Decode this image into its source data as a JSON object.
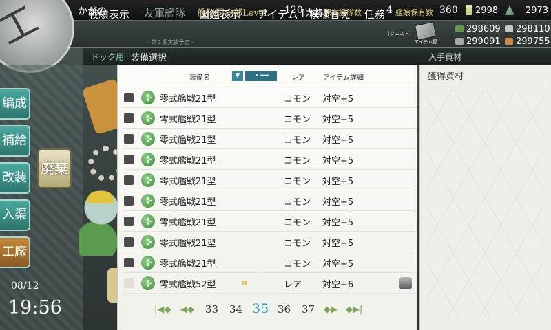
{
  "header": {
    "admiral_name": "かがの",
    "hq_label": "艦隊司令部Level.",
    "hq_level": "120",
    "rank": "[大将]",
    "ships_label": "保有艦隊数",
    "ships_count": "4",
    "equipment_label": "艦娘保有数",
    "equipment_count": "360",
    "bucket_count": "2998",
    "devmat_count": "2973"
  },
  "badge": {
    "text": "工"
  },
  "menu": {
    "record": "戦績表示",
    "friend": "友軍艦隊",
    "friend_sub": "- 第２期実装予定 -",
    "library": "図鑑表示",
    "items": "アイテム",
    "remodel": "模様替え",
    "quest": "任務",
    "quest_sub": "(クエスト)",
    "item_shop": "アイテム屋"
  },
  "resources": {
    "fuel": "298609",
    "ammo": "298110",
    "steel": "299091",
    "bauxite": "299755"
  },
  "breadcrumb": {
    "dock": "ドック用",
    "select": "装備選択",
    "acquired": "入手資材"
  },
  "side_menu": {
    "hensei": "編成",
    "hokyu": "補給",
    "kaiso": "改装",
    "nyukyo": "入渠",
    "kosho": "工廠",
    "haiki": "廃棄"
  },
  "clock": {
    "date": "08/12",
    "time": "19:56"
  },
  "list": {
    "headers": {
      "name": "装備名",
      "rarity": "レア",
      "detail": "アイテム詳細"
    },
    "sort_mode": "・━━",
    "rows": [
      {
        "name": "零式艦戦21型",
        "rarity": "コモン",
        "detail": "対空+5"
      },
      {
        "name": "零式艦戦21型",
        "rarity": "コモン",
        "detail": "対空+5"
      },
      {
        "name": "零式艦戦21型",
        "rarity": "コモン",
        "detail": "対空+5"
      },
      {
        "name": "零式艦戦21型",
        "rarity": "コモン",
        "detail": "対空+5"
      },
      {
        "name": "零式艦戦21型",
        "rarity": "コモン",
        "detail": "対空+5"
      },
      {
        "name": "零式艦戦21型",
        "rarity": "コモン",
        "detail": "対空+5"
      },
      {
        "name": "零式艦戦21型",
        "rarity": "コモン",
        "detail": "対空+5"
      },
      {
        "name": "零式艦戦21型",
        "rarity": "コモン",
        "detail": "対空+5"
      },
      {
        "name": "零式艦戦21型",
        "rarity": "コモン",
        "detail": "対空+5"
      },
      {
        "name": "零式艦戦52型",
        "rarity": "レア",
        "detail": "対空+6"
      }
    ],
    "marker": "»"
  },
  "pager": {
    "pages": [
      "33",
      "34",
      "35",
      "36",
      "37"
    ],
    "current": "35"
  },
  "acquired_panel": {
    "title": "獲得資材"
  },
  "colors": {
    "accent": "#2fa0b8",
    "gold_label": "#d9c47b"
  }
}
